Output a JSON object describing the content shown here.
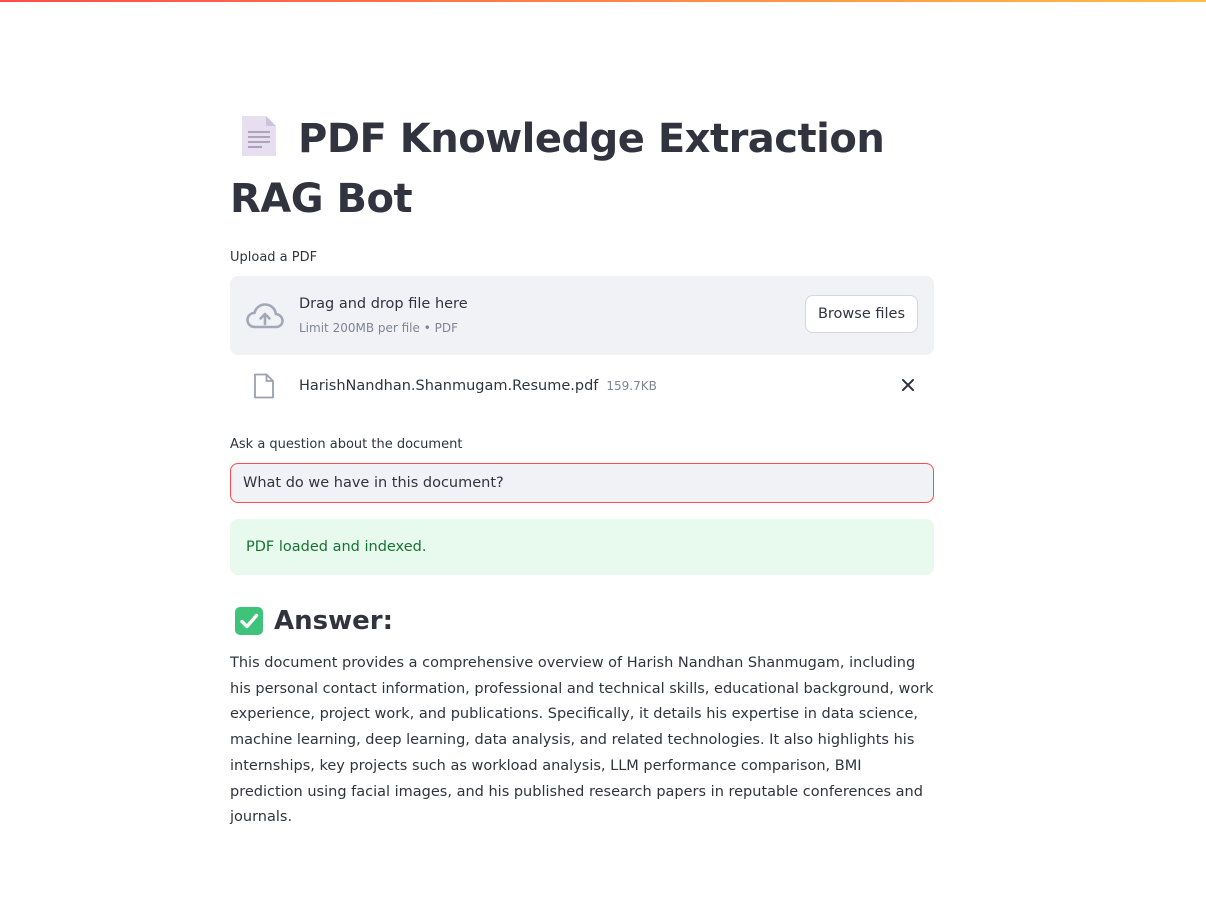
{
  "page": {
    "title": "PDF Knowledge Extraction RAG Bot",
    "title_icon": "page-facing-up-icon"
  },
  "uploader": {
    "label": "Upload a PDF",
    "drop_text": "Drag and drop file here",
    "limit_text": "Limit 200MB per file • PDF",
    "browse_label": "Browse files",
    "icon": "cloud-upload-icon"
  },
  "uploaded_file": {
    "name": "HarishNandhan.Shanmugam.Resume.pdf",
    "size": "159.7KB",
    "icon": "file-icon",
    "remove_icon": "close-icon"
  },
  "question": {
    "label": "Ask a question about the document",
    "value": "What do we have in this document?"
  },
  "status": {
    "message": "PDF loaded and indexed."
  },
  "answer": {
    "heading": "Answer:",
    "heading_icon": "check-mark-button-icon",
    "text": "This document provides a comprehensive overview of Harish Nandhan Shanmugam, including his personal contact information, professional and technical skills, educational background, work experience, project work, and publications. Specifically, it details his expertise in data science, machine learning, deep learning, data analysis, and related technologies. It also highlights his internships, key projects such as workload analysis, LLM performance comparison, BMI prediction using facial images, and his published research papers in reputable conferences and journals."
  },
  "colors": {
    "accent": "#ff4b4b",
    "success_bg": "#e8f9ee",
    "success_text": "#177233",
    "widget_bg": "#f0f2f6",
    "text": "#31333f"
  }
}
